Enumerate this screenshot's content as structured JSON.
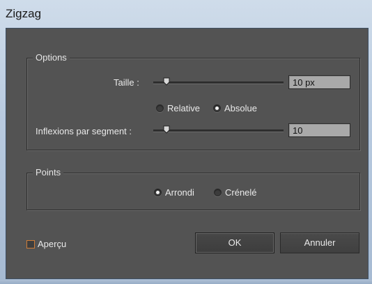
{
  "window": {
    "title": "Zigzag"
  },
  "options": {
    "legend": "Options",
    "taille": {
      "label": "Taille :",
      "value": "10 px",
      "slider_fraction": 0.1
    },
    "mode": {
      "relative_label": "Relative",
      "absolute_label": "Absolue",
      "selected": "Absolue"
    },
    "inflexions": {
      "label": "Inflexions par segment :",
      "value": "10",
      "slider_fraction": 0.1
    }
  },
  "points": {
    "legend": "Points",
    "arrondi_label": "Arrondi",
    "crenele_label": "Crénelé",
    "selected": "Arrondi"
  },
  "footer": {
    "preview_label": "Aperçu",
    "preview_checked": false,
    "ok_label": "OK",
    "cancel_label": "Annuler"
  },
  "colors": {
    "dialog_background": "#535353",
    "field_background": "#a9a9a9",
    "checkbox_border": "#d07d38"
  }
}
